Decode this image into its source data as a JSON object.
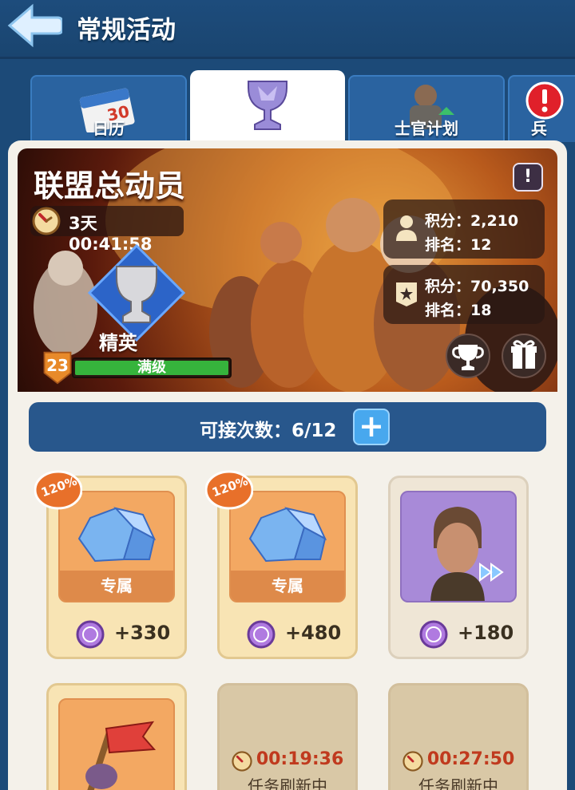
{
  "header": {
    "title": "常规活动"
  },
  "tabs": [
    {
      "label": "日历",
      "icon": "calendar-icon",
      "active": false
    },
    {
      "label": "",
      "icon": "trophy-icon",
      "active": true
    },
    {
      "label": "士官计划",
      "icon": "soldier-icon",
      "active": false
    },
    {
      "label": "兵",
      "icon": "alert-icon",
      "active": false
    }
  ],
  "calendar_day": "30",
  "hero": {
    "title": "联盟总动员",
    "info_label": "!",
    "countdown": "3天 00:41:58",
    "rank_name": "精英",
    "level": "23",
    "level_status": "满级",
    "level_progress": 1.0,
    "personal": {
      "score_label": "积分：",
      "score": "2,210",
      "rank_label": "排名：",
      "rank": "12"
    },
    "alliance": {
      "score_label": "积分：",
      "score": "70,350",
      "rank_label": "排名：",
      "rank": "18"
    }
  },
  "counter": {
    "label": "可接次数：6/12",
    "plus": "+"
  },
  "cards": [
    {
      "bonus": "120%",
      "tag": "专属",
      "reward": "+330"
    },
    {
      "bonus": "120%",
      "tag": "专属",
      "reward": "+480"
    },
    {
      "reward": "+180"
    },
    {},
    {
      "countdown": "00:19:36",
      "status": "任务刷新中"
    },
    {
      "countdown": "00:27:50",
      "status": "任务刷新中"
    }
  ],
  "colors": {
    "accent_blue": "#1c4a78",
    "progress_green": "#36b43c",
    "timer_red": "#c03a1e",
    "coin_purple": "#9a4ec8"
  }
}
